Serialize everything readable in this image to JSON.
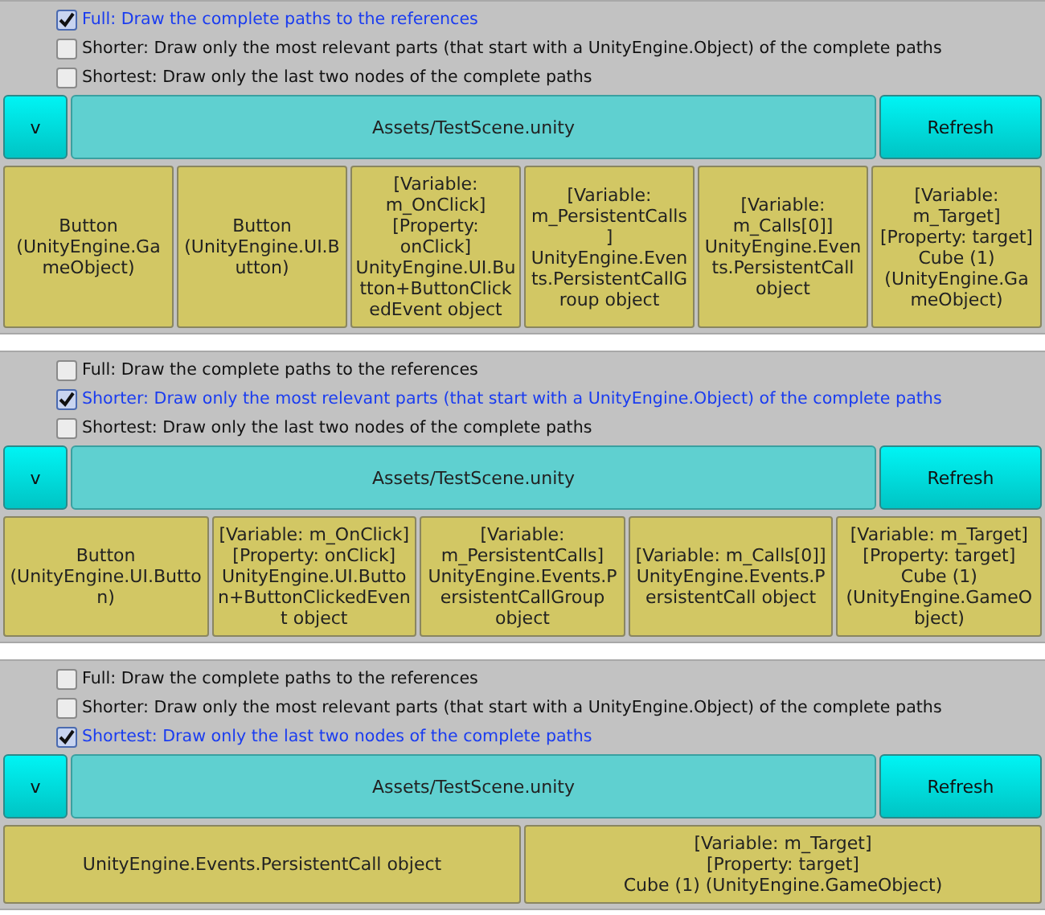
{
  "panels": [
    {
      "options": [
        {
          "label": "Full: Draw the complete paths to the references",
          "checked": true
        },
        {
          "label": "Shorter: Draw only the most relevant parts (that start with a UnityEngine.Object) of the complete paths",
          "checked": false
        },
        {
          "label": "Shortest: Draw only the last two nodes of the complete paths",
          "checked": false
        }
      ],
      "toggle": "v",
      "path": "Assets/TestScene.unity",
      "refresh": "Refresh",
      "nodes": [
        "Button (UnityEngine.GameObject)",
        "Button (UnityEngine.UI.Button)",
        "[Variable: m_OnClick]\n[Property: onClick]\nUnityEngine.UI.Button+ButtonClickedEvent object",
        "[Variable: m_PersistentCalls]\nUnityEngine.Events.PersistentCallGroup object",
        "[Variable: m_Calls[0]]\nUnityEngine.Events.PersistentCall object",
        "[Variable: m_Target]\n[Property: target]\nCube (1) (UnityEngine.GameObject)"
      ]
    },
    {
      "options": [
        {
          "label": "Full: Draw the complete paths to the references",
          "checked": false
        },
        {
          "label": "Shorter: Draw only the most relevant parts (that start with a UnityEngine.Object) of the complete paths",
          "checked": true
        },
        {
          "label": "Shortest: Draw only the last two nodes of the complete paths",
          "checked": false
        }
      ],
      "toggle": "v",
      "path": "Assets/TestScene.unity",
      "refresh": "Refresh",
      "nodes": [
        "Button (UnityEngine.UI.Button)",
        "[Variable: m_OnClick]\n[Property: onClick]\nUnityEngine.UI.Button+ButtonClickedEvent object",
        "[Variable: m_PersistentCalls]\nUnityEngine.Events.PersistentCallGroup object",
        "[Variable: m_Calls[0]]\nUnityEngine.Events.PersistentCall object",
        "[Variable: m_Target]\n[Property: target]\nCube (1) (UnityEngine.GameObject)"
      ]
    },
    {
      "options": [
        {
          "label": "Full: Draw the complete paths to the references",
          "checked": false
        },
        {
          "label": "Shorter: Draw only the most relevant parts (that start with a UnityEngine.Object) of the complete paths",
          "checked": false
        },
        {
          "label": "Shortest: Draw only the last two nodes of the complete paths",
          "checked": true
        }
      ],
      "toggle": "v",
      "path": "Assets/TestScene.unity",
      "refresh": "Refresh",
      "nodes": [
        "UnityEngine.Events.PersistentCall object",
        "[Variable: m_Target]\n[Property: target]\nCube (1) (UnityEngine.GameObject)"
      ]
    }
  ]
}
